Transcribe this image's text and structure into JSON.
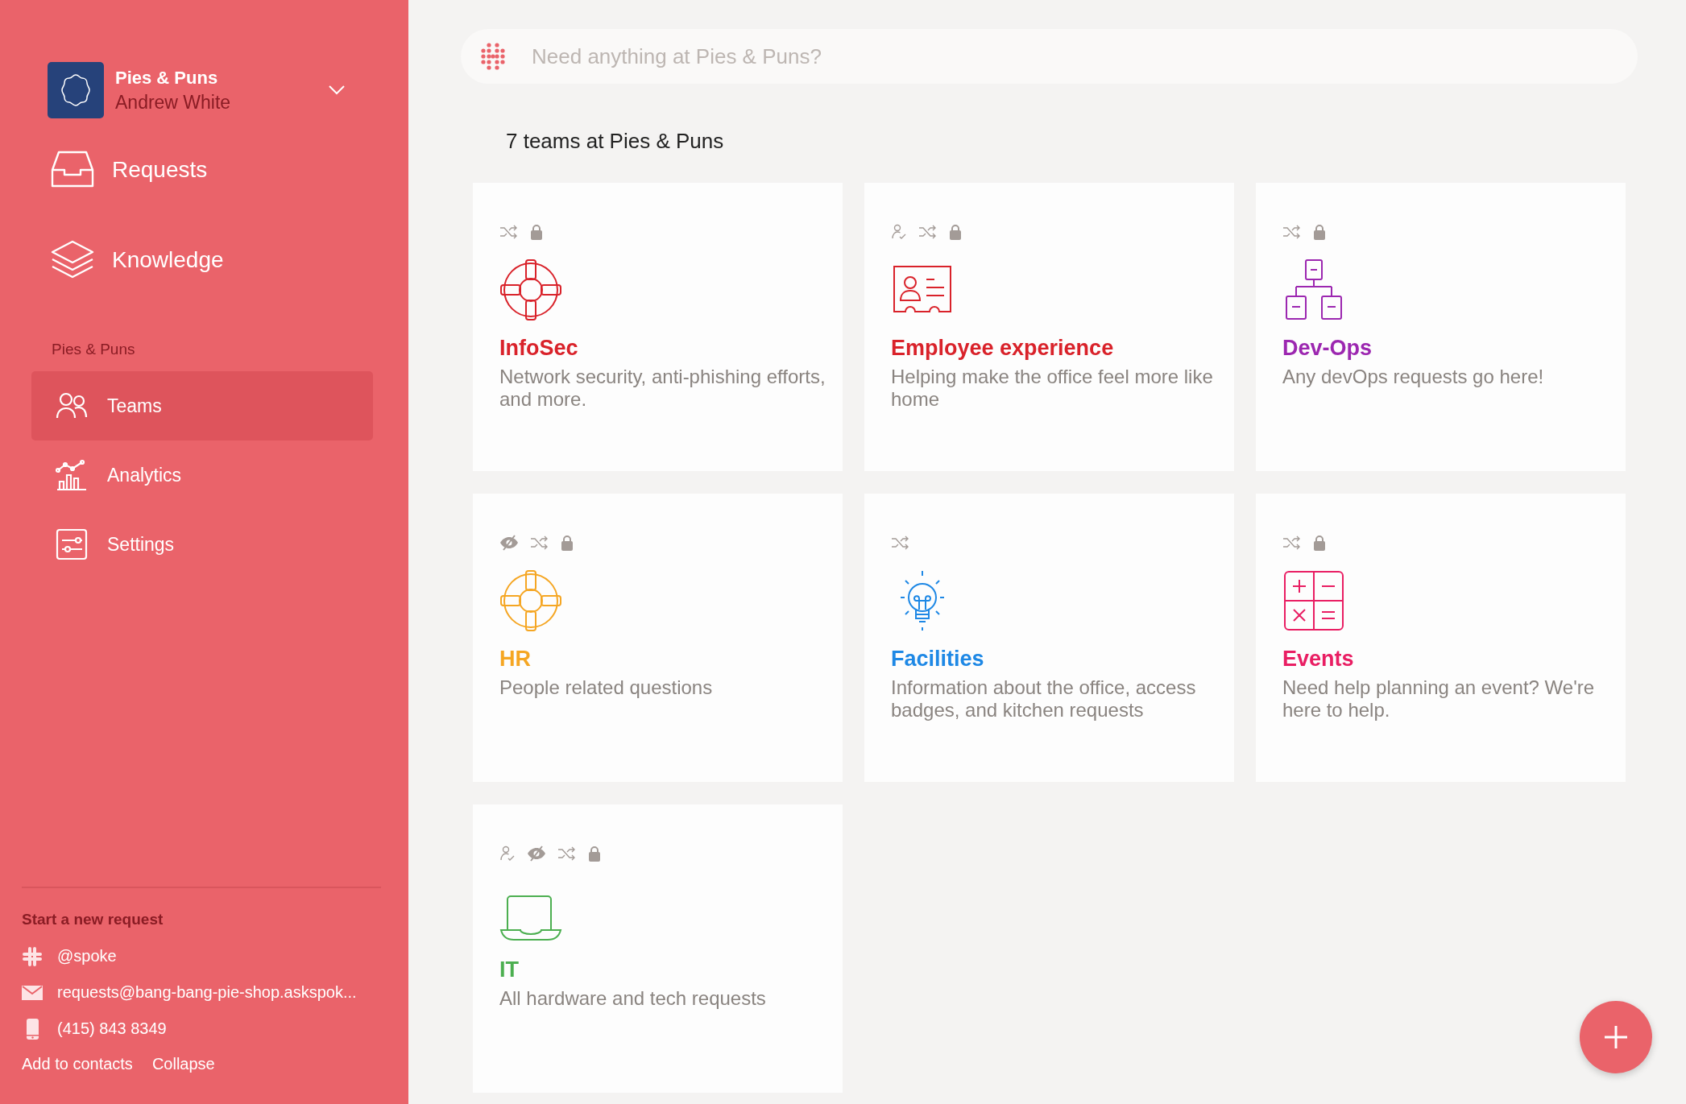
{
  "sidebar": {
    "org": {
      "name": "Pies & Puns",
      "user": "Andrew White"
    },
    "main_nav": [
      {
        "label": "Requests",
        "kind": "inbox",
        "selected": false
      },
      {
        "label": "Knowledge",
        "kind": "layers",
        "selected": false
      }
    ],
    "section_label": "Pies & Puns",
    "section_nav": [
      {
        "label": "Teams",
        "kind": "people",
        "selected": true
      },
      {
        "label": "Analytics",
        "kind": "analytics",
        "selected": false
      },
      {
        "label": "Settings",
        "kind": "sliders",
        "selected": false
      }
    ],
    "footer": {
      "title": "Start a new request",
      "contacts": [
        {
          "kind": "chat",
          "text": "@spoke"
        },
        {
          "kind": "email",
          "text": "requests@bang-bang-pie-shop.askspok..."
        },
        {
          "kind": "phone",
          "text": "(415) 843 8349"
        }
      ],
      "links": [
        "Add to contacts",
        "Collapse"
      ]
    }
  },
  "search": {
    "placeholder": "Need anything at Pies & Puns?"
  },
  "heading": "7 teams at Pies & Puns",
  "teams": [
    {
      "name": "InfoSec",
      "description": "Network security, anti-phishing efforts, and more.",
      "kind": "lifebuoy",
      "color": "#d9222a",
      "assigned": false,
      "hidden": false,
      "shuffle": true,
      "locked": true
    },
    {
      "name": "Employee experience",
      "description": "Helping make the office feel more like home",
      "kind": "id-card",
      "color": "#d9222a",
      "assigned": true,
      "hidden": false,
      "shuffle": true,
      "locked": true
    },
    {
      "name": "Dev-Ops",
      "description": "Any devOps requests go here!",
      "kind": "org-chart",
      "color": "#9c27b0",
      "assigned": false,
      "hidden": false,
      "shuffle": true,
      "locked": true
    },
    {
      "name": "HR",
      "description": "People related questions",
      "kind": "lifebuoy",
      "color": "#f5a623",
      "assigned": false,
      "hidden": true,
      "shuffle": true,
      "locked": true
    },
    {
      "name": "Facilities",
      "description": "Information about the office, access badges, and kitchen requests",
      "kind": "lightbulb",
      "color": "#1e88e5",
      "assigned": false,
      "hidden": false,
      "shuffle": true,
      "locked": false
    },
    {
      "name": "Events",
      "description": "Need help planning an event? We're here to help.",
      "kind": "calculator",
      "color": "#e91e63",
      "assigned": false,
      "hidden": false,
      "shuffle": true,
      "locked": true
    },
    {
      "name": "IT",
      "description": "All hardware and tech requests",
      "kind": "laptop",
      "color": "#4caf50",
      "assigned": true,
      "hidden": true,
      "shuffle": true,
      "locked": true
    }
  ]
}
